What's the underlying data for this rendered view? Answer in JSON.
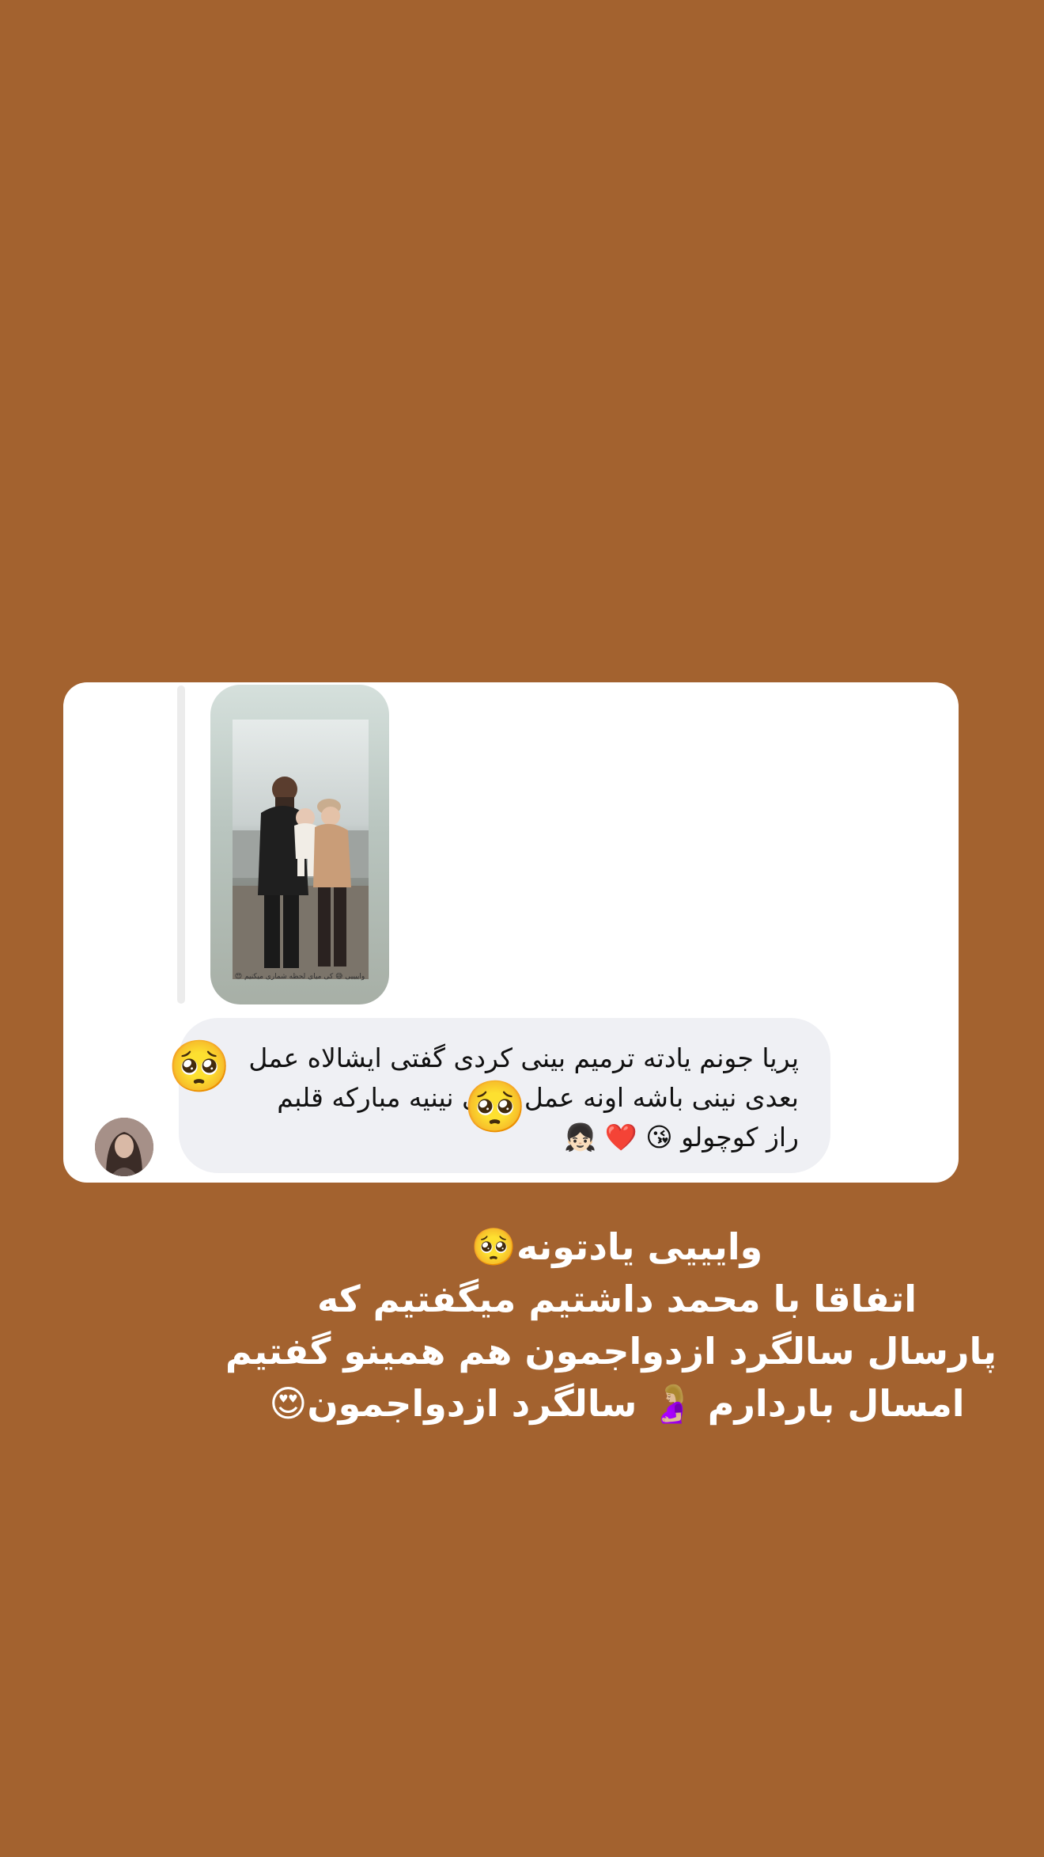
{
  "reply_card": {
    "story_caption": "واییییی 😅 کی میای لحظه شماری میکنیم 😍",
    "message_line_1": "پریا جونم یادته ترمیم بینی کردی گفتی ایشالاه عمل",
    "message_line_2": "بعدی نینی باشه اونه عمل بعدی نینیه مبارکه قلبم",
    "message_line_3": "راز کوچولو 😘 ❤️ 👧🏻",
    "emoji_left": "🥺",
    "emoji_middle": "🥺"
  },
  "overlay": {
    "line_1": "وایییی یادتونه🥺",
    "line_2": "اتفاقا با محمد داشتیم میگفتیم که",
    "line_3": "پارسال سالگرد ازدواجمون هم همینو گفتیم",
    "line_4": "امسال باردارم 🤰🏼 سالگرد ازدواجمون😍"
  },
  "colors": {
    "background": "#A3622F",
    "card": "#FFFFFF",
    "bubble": "#EFF0F4",
    "text_overlay": "#FFFFFF"
  }
}
